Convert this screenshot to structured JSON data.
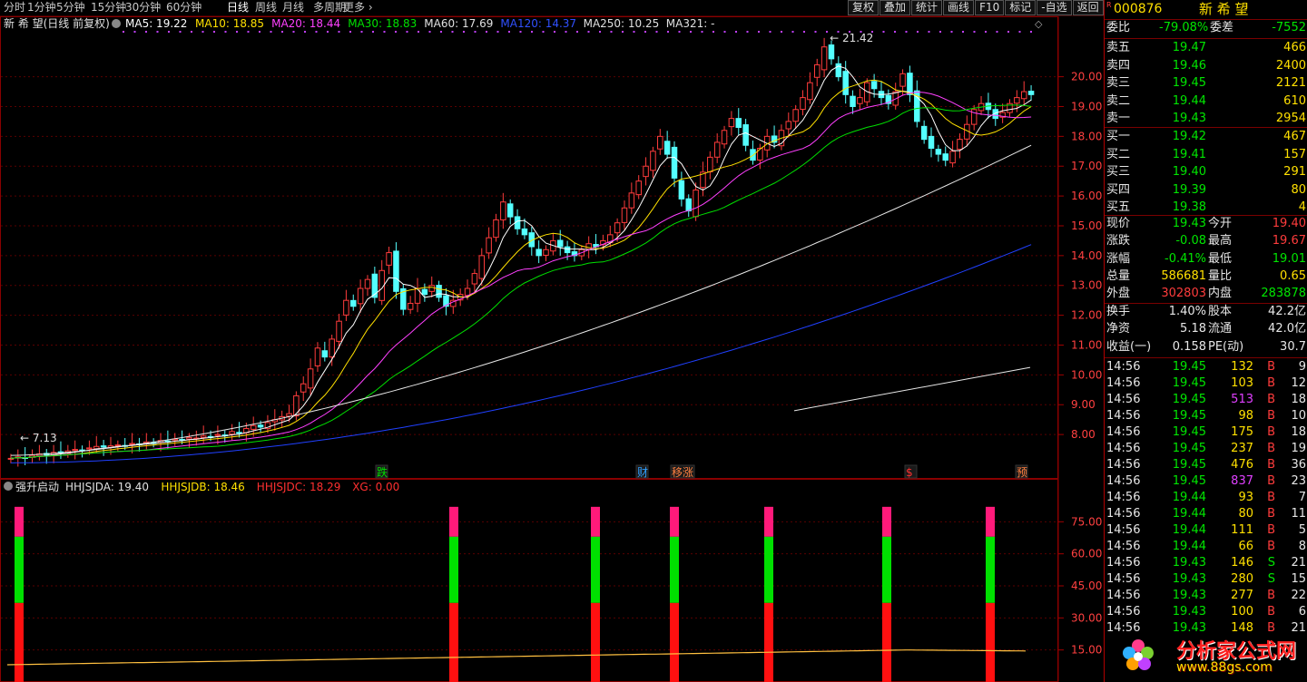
{
  "topbar": {
    "periods": [
      "分时",
      "1分钟",
      "5分钟",
      "15分钟",
      "30分钟",
      "60分钟",
      "日线",
      "周线",
      "月线",
      "多周期",
      "更多"
    ],
    "active_period": "日线",
    "tools": [
      "复权",
      "叠加",
      "统计",
      "画线",
      "F10",
      "标记",
      "-自选",
      "返回"
    ]
  },
  "main_chart": {
    "title": "新 希 望(日线 前复权)",
    "ma_labels": [
      {
        "text": "MA5: 19.22",
        "color": "#ffffff"
      },
      {
        "text": "MA10: 18.85",
        "color": "#ffe000"
      },
      {
        "text": "MA20: 18.44",
        "color": "#ff40ff"
      },
      {
        "text": "MA30: 18.83",
        "color": "#00e000"
      },
      {
        "text": "MA60: 17.69",
        "color": "#e0e0e0"
      },
      {
        "text": "MA120: 14.37",
        "color": "#3050ff"
      },
      {
        "text": "MA250: 10.25",
        "color": "#e0e0e0"
      },
      {
        "text": "MA321: -",
        "color": "#e0e0e0"
      }
    ],
    "price_axis": [
      "20.00",
      "19.00",
      "18.00",
      "17.00",
      "16.00",
      "15.00",
      "14.00",
      "13.00",
      "12.00",
      "11.00",
      "10.00",
      "9.00",
      "8.00"
    ],
    "high_marker": "21.42",
    "low_marker": "7.13",
    "event_markers": [
      {
        "text": "跌",
        "color": "#00e000"
      },
      {
        "text": "财",
        "color": "#30a0ff"
      },
      {
        "text": "移涨",
        "color": "#ff8040"
      },
      {
        "text": "$",
        "color": "#ff3030"
      },
      {
        "text": "预",
        "color": "#ff8040"
      }
    ]
  },
  "indicator": {
    "name": "强升启动",
    "values": [
      {
        "text": "HHJSJDA: 19.40",
        "color": "#e0e0e0"
      },
      {
        "text": "HHJSJDB: 18.46",
        "color": "#ffe000"
      },
      {
        "text": "HHJSJDC: 18.29",
        "color": "#ff3030"
      },
      {
        "text": "XG: 0.00",
        "color": "#ff3030"
      }
    ],
    "axis": [
      "75.00",
      "60.00",
      "45.00",
      "30.00",
      "15.00"
    ]
  },
  "chart_data": {
    "type": "candlestick",
    "title": "新 希 望(日线 前复权)",
    "ylim": [
      7.0,
      21.6
    ],
    "high": 21.42,
    "low": 7.13,
    "ma_latest": {
      "MA5": 19.22,
      "MA10": 18.85,
      "MA20": 18.44,
      "MA30": 18.83,
      "MA60": 17.69,
      "MA120": 14.37,
      "MA250": 10.25
    },
    "closes": [
      7.2,
      7.25,
      7.22,
      7.3,
      7.35,
      7.32,
      7.4,
      7.38,
      7.45,
      7.5,
      7.48,
      7.55,
      7.6,
      7.58,
      7.62,
      7.65,
      7.63,
      7.7,
      7.68,
      7.75,
      7.72,
      7.8,
      7.78,
      7.85,
      7.82,
      7.9,
      7.88,
      7.95,
      7.93,
      8.0,
      7.98,
      8.1,
      8.05,
      8.2,
      8.3,
      8.25,
      8.4,
      8.5,
      8.6,
      8.7,
      9.3,
      9.7,
      10.2,
      10.9,
      10.6,
      11.2,
      11.8,
      12.5,
      12.3,
      12.9,
      13.2,
      12.6,
      13.5,
      14.1,
      12.8,
      12.2,
      12.4,
      12.9,
      12.7,
      13.0,
      12.6,
      12.3,
      12.5,
      12.7,
      12.9,
      13.4,
      14.0,
      14.6,
      15.2,
      15.8,
      15.3,
      14.9,
      14.7,
      14.3,
      14.0,
      14.2,
      14.5,
      14.3,
      14.1,
      14.0,
      14.2,
      14.4,
      14.3,
      14.5,
      14.7,
      15.1,
      15.6,
      16.1,
      16.5,
      17.0,
      17.5,
      18.0,
      17.4,
      16.6,
      15.9,
      15.5,
      16.2,
      16.8,
      17.3,
      17.8,
      18.2,
      18.6,
      18.3,
      17.7,
      17.2,
      17.6,
      18.0,
      17.8,
      18.2,
      18.5,
      18.9,
      19.3,
      19.8,
      20.4,
      21.0,
      20.6,
      20.0,
      19.4,
      19.0,
      19.3,
      19.8,
      19.6,
      19.3,
      19.1,
      19.5,
      20.1,
      19.4,
      18.5,
      17.9,
      17.6,
      17.4,
      17.2,
      17.5,
      17.9,
      18.4,
      18.9,
      19.1,
      18.9,
      18.6,
      18.8,
      19.1,
      19.3,
      19.5,
      19.4
    ]
  }
}
